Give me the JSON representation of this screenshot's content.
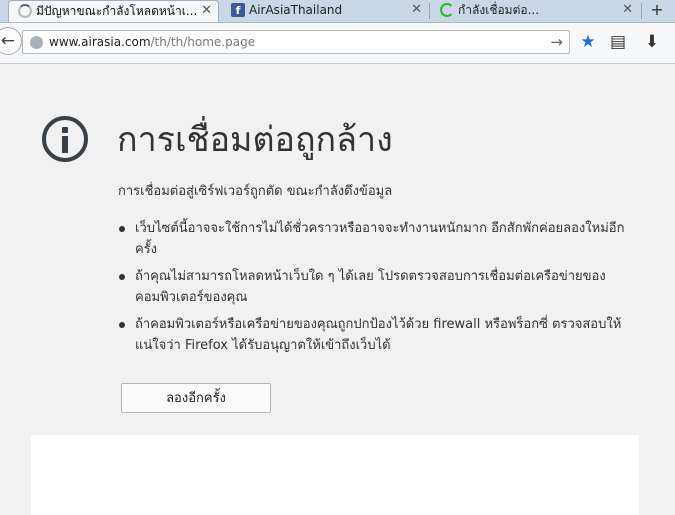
{
  "tabs": [
    {
      "title": "มีปัญหาขณะกำลังโหลดหน้าเ...",
      "close": "✕"
    },
    {
      "title": "AirAsiaThailand",
      "close": "✕"
    },
    {
      "title": "กำลังเชื่อมต่อ...",
      "close": "✕"
    }
  ],
  "new_tab_label": "+",
  "navbar": {
    "back_glyph": "←",
    "url_domain": "www.airasia.com",
    "url_path": "/th/th/home.page",
    "go_glyph": "→",
    "bookmark_glyph": "★",
    "reader_glyph": "▤",
    "download_glyph": "⬇"
  },
  "error": {
    "title": "การเชื่อมต่อถูกล้าง",
    "summary": "การเชื่อมต่อสู่เซิร์ฟเวอร์ถูกตัด ขณะกำลังดึงข้อมูล",
    "items": [
      "เว็บไซต์นี้อาจจะใช้การไม่ได้ชั่วคราวหรืออาจจะทำงานหนักมาก อีกสักพักค่อยลองใหม่อีก ครั้ง",
      "ถ้าคุณไม่สามารถโหลดหน้าเว็บใด ๆ ได้เลย โปรดตรวจสอบการเชื่อมต่อเครือข่ายของ คอมพิวเตอร์ของคุณ",
      "ถ้าคอมพิวเตอร์หรือเครือข่ายของคุณถูกปกป้องไว้ด้วย firewall หรือพร็อกซี่ ตรวจสอบให้แน่ใจว่า Firefox ได้รับอนุญาตให้เข้าถึงเว็บได้"
    ],
    "try_again_label": "ลองอีกครั้ง"
  },
  "icons": {
    "tab1": "loading-icon",
    "tab2": "facebook-icon",
    "tab3": "spinner-icon",
    "page": "info-icon"
  },
  "colors": {
    "accent": "#1f6fd8",
    "facebook": "#3b5998",
    "spinner": "#2fb52f",
    "page_bg": "#f1f1f1"
  }
}
